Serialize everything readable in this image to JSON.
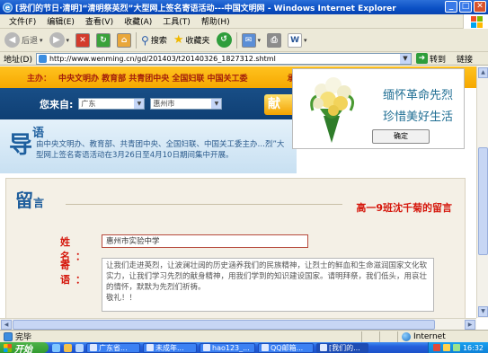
{
  "window": {
    "title": "[我们的节日·清明]“清明祭英烈”大型网上签名寄语活动---中国文明网 - Windows Internet Explorer",
    "buttons": [
      "_",
      "□",
      "✕"
    ]
  },
  "menu": [
    "文件(F)",
    "编辑(E)",
    "查看(V)",
    "收藏(A)",
    "工具(T)",
    "帮助(H)"
  ],
  "toolbar": {
    "back": "后退",
    "search": "搜索",
    "favorites": "收藏夹"
  },
  "address": {
    "label": "地址(D)",
    "url": "http://www.wenming.cn/gd/201403/t20140326_1827312.shtml",
    "go": "转到",
    "links": "链接"
  },
  "page": {
    "organizers_label": "主办：",
    "organizers": "中央文明办  教育部  共青团中央  全国妇联  中国关工委",
    "co_label": "承办：",
    "location_prompt": "您来自:",
    "province": "广东",
    "city": "惠州市",
    "submit_partial": "献",
    "intro_big": "导",
    "intro_small": "语",
    "intro_text": "由中央文明办、教育部、共青团中央、全国妇联、中国关工委主办…烈”大型网上签名寄语活动在3月26日至4月10日期间集中开展。",
    "msg_head_big": "留",
    "msg_head_small": "言",
    "msg_title": "高一9班沈千菊的留言",
    "name_label": "姓名：",
    "name_value": "惠州市实验中学",
    "message_label": "寄语：",
    "message_text": "让我们走进英烈，让波澜壮阔的历史涵养我们的民族精神，让烈士的鲜血和生命滋润国家文化软实力，让我们学习先烈的献身精神，用我们学到的知识建设国家。请明拜祭，我们低头，用哀壮的情怀，默默为先烈们祈祷。\n敬礼！！"
  },
  "popup": {
    "line1": "缅怀革命先烈",
    "line2": "珍惜美好生活",
    "ok": "确定"
  },
  "status": {
    "done": "完毕",
    "zone": "Internet"
  },
  "taskbar": {
    "start": "开始",
    "tasks": [
      "广东省...",
      "未成年...",
      "hao123_...",
      "QQ邮箱...",
      "[我们的..."
    ],
    "clock": "16:32"
  }
}
